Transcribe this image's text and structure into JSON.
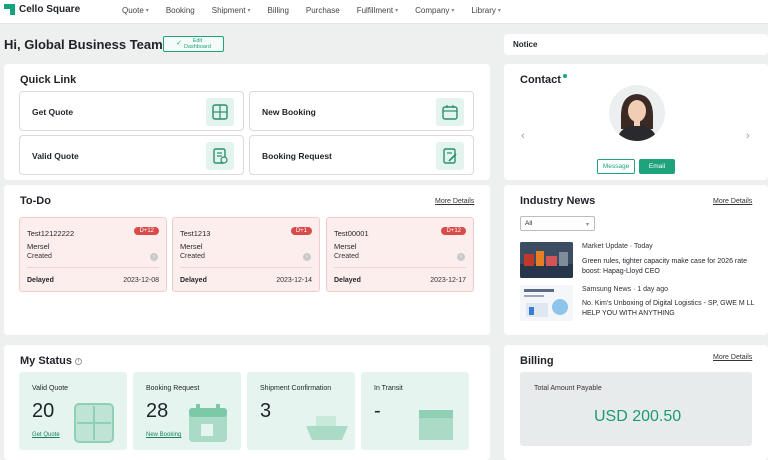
{
  "app": {
    "name": "Cello Square"
  },
  "nav": {
    "items": [
      {
        "label": "Quote",
        "dropdown": true
      },
      {
        "label": "Booking",
        "dropdown": false
      },
      {
        "label": "Shipment",
        "dropdown": true
      },
      {
        "label": "Billing",
        "dropdown": false
      },
      {
        "label": "Purchase",
        "dropdown": false
      },
      {
        "label": "Fulfillment",
        "dropdown": true
      },
      {
        "label": "Company",
        "dropdown": true
      },
      {
        "label": "Library",
        "dropdown": true
      }
    ]
  },
  "header": {
    "greeting": "Hi, Global Business Team!",
    "edit_button": {
      "line1": "Edit",
      "line2": "Dashboard"
    }
  },
  "notice": {
    "title": "Notice"
  },
  "quick_link": {
    "title": "Quick Link",
    "items": [
      {
        "label": "Get Quote",
        "icon": "calculator-icon"
      },
      {
        "label": "New Booking",
        "icon": "calendar-icon"
      },
      {
        "label": "Valid Quote",
        "icon": "document-check-icon"
      },
      {
        "label": "Booking Request",
        "icon": "document-edit-icon"
      }
    ]
  },
  "contact": {
    "title": "Contact",
    "message_button": "Message",
    "email_button": "Email"
  },
  "todo": {
    "title": "To-Do",
    "more": "More Details",
    "cards": [
      {
        "id": "Test12122222",
        "badge": "D+12",
        "vessel": "Mersel",
        "status": "Created",
        "delay": "Delayed",
        "date": "2023-12-08"
      },
      {
        "id": "Test1213",
        "badge": "D+1",
        "vessel": "Mersel",
        "status": "Created",
        "delay": "Delayed",
        "date": "2023-12-14"
      },
      {
        "id": "Test00001",
        "badge": "D+12",
        "vessel": "Mersel",
        "status": "Created",
        "delay": "Delayed",
        "date": "2023-12-17"
      }
    ]
  },
  "industry_news": {
    "title": "Industry News",
    "more": "More Details",
    "filter": "All",
    "items": [
      {
        "meta": "Market Update · Today",
        "headline": "Green rules, tighter capacity make case for 2026 rate boost: Hapag-Lloyd CEO"
      },
      {
        "meta": "Samsung News · 1 day ago",
        "headline": "No. Kim's Unboxing of Digital Logistics - SP, GWE M LL HELP YOU WITH ANYTHING"
      }
    ]
  },
  "my_status": {
    "title": "My Status",
    "cards": [
      {
        "label": "Valid Quote",
        "value": "20",
        "link": "Get Quote"
      },
      {
        "label": "Booking Request",
        "value": "28",
        "link": "New Booking"
      },
      {
        "label": "Shipment Confirmation",
        "value": "3",
        "link": ""
      },
      {
        "label": "In Transit",
        "value": "-",
        "link": ""
      }
    ]
  },
  "billing": {
    "title": "Billing",
    "more": "More Details",
    "label": "Total Amount Payable",
    "amount": "USD 200.50"
  },
  "colors": {
    "accent": "#1fa37c",
    "alert": "#d94a4a",
    "todo_bg": "#fdeeee",
    "status_bg": "#e5f4ee"
  }
}
